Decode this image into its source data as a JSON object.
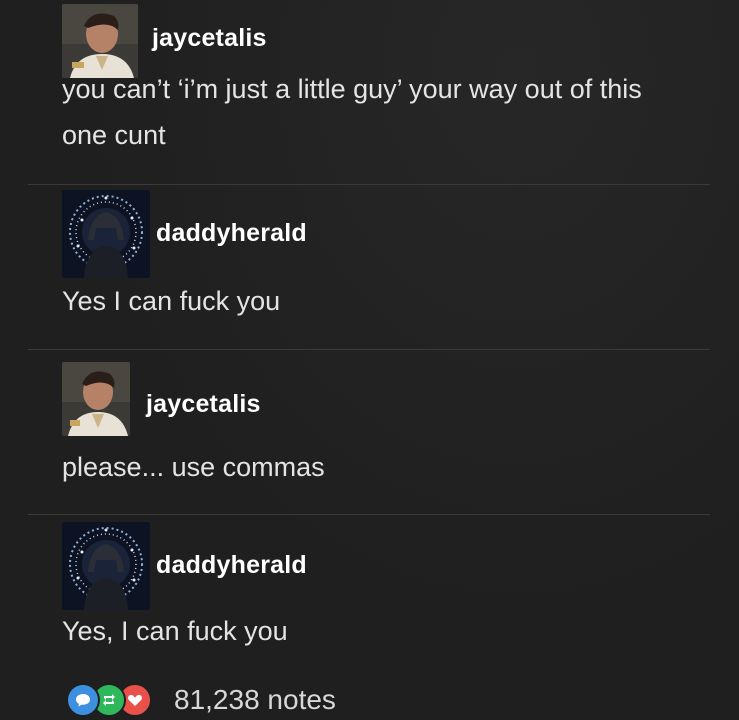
{
  "thread": {
    "posts": [
      {
        "username": "jaycetalis",
        "text": "you can’t ‘i’m just a little guy’ your way out of this one cunt",
        "avatar": "jayce-avatar"
      },
      {
        "username": "daddyherald",
        "text": "Yes I can fuck you",
        "avatar": "herald-avatar"
      },
      {
        "username": "jaycetalis",
        "text": "please... use commas",
        "avatar": "jayce-avatar"
      },
      {
        "username": "daddyherald",
        "text": "Yes, I can fuck you",
        "avatar": "herald-avatar"
      }
    ]
  },
  "footer": {
    "notes_label": "81,238 notes",
    "icons": [
      "reply-icon",
      "reblog-icon",
      "like-icon"
    ],
    "colors": {
      "reply": "#3d8fe0",
      "reblog": "#2fb75c",
      "like": "#e8514a"
    }
  }
}
